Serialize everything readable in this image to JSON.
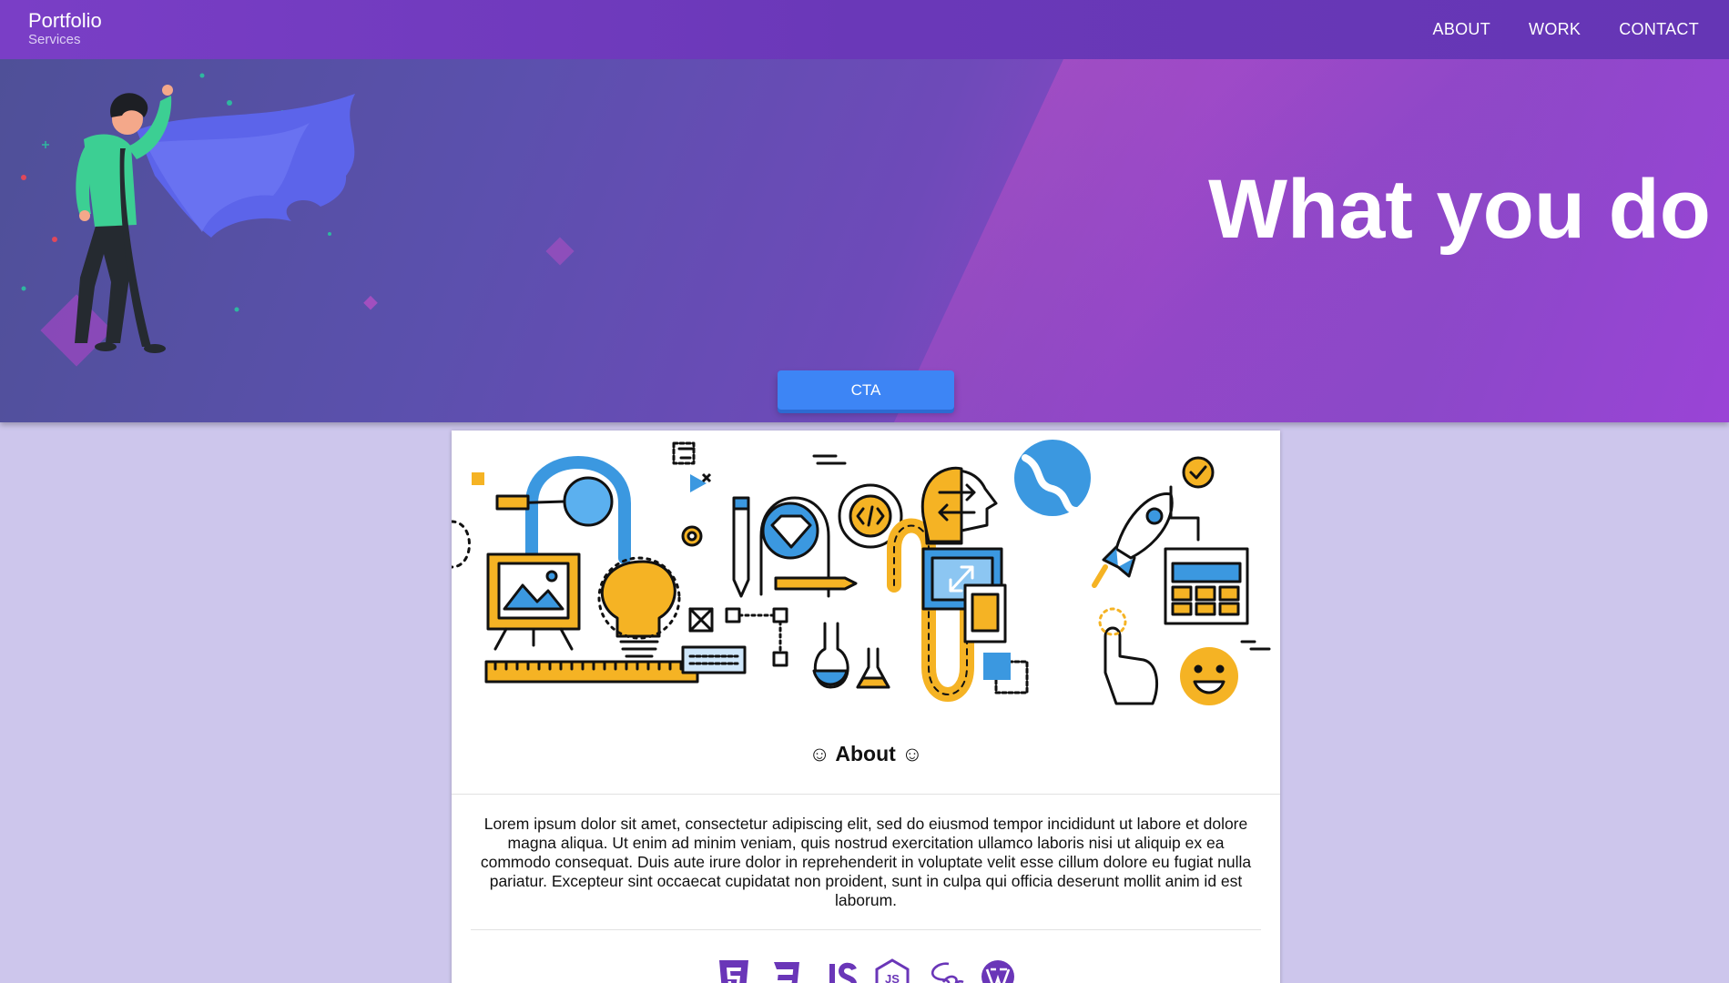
{
  "header": {
    "brand_title": "Portfolio",
    "brand_subtitle": "Services",
    "nav": [
      "ABOUT",
      "WORK",
      "CONTACT"
    ]
  },
  "hero": {
    "title": "What you do",
    "cta_label": "CTA",
    "illustration": "hero-with-cape-icon"
  },
  "about": {
    "title": "☺ About ☺",
    "body": "Lorem ipsum dolor sit amet, consectetur adipiscing elit, sed do eiusmod tempor incididunt ut labore et dolore magna aliqua. Ut enim ad minim veniam, quis nostrud exercitation ullamco laboris nisi ut aliquip ex ea commodo consequat. Duis aute irure dolor in reprehenderit in voluptate velit esse cillum dolore eu fugiat nulla pariatur. Excepteur sint occaecat cupidatat non proident, sunt in culpa qui officia deserunt mollit anim id est laborum.",
    "illustration": "web-development-line-art-icon",
    "tech_icons": [
      "html5-icon",
      "css3-icon",
      "javascript-icon",
      "nodejs-icon",
      "sass-icon",
      "wordpress-icon"
    ]
  },
  "colors": {
    "header_bg": "#6a38b8",
    "page_bg": "#cdc6ec",
    "cta_bg": "#3d85f5",
    "tech_icon": "#6a36b8",
    "illus_blue": "#3b98e0",
    "illus_yellow": "#f5b324"
  }
}
